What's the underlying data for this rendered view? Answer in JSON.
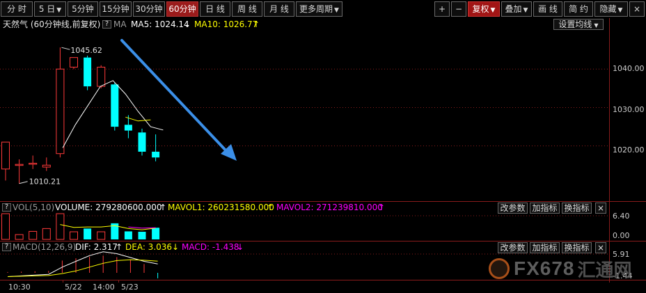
{
  "toolbar": {
    "periods": [
      {
        "label": "分 时"
      },
      {
        "label": "5 日",
        "dropdown": true
      },
      {
        "label": "5分钟"
      },
      {
        "label": "15分钟"
      },
      {
        "label": "30分钟"
      },
      {
        "label": "60分钟",
        "active": true
      },
      {
        "label": "日 线"
      },
      {
        "label": "周 线"
      },
      {
        "label": "月 线"
      },
      {
        "label": "更多周期",
        "dropdown": true
      }
    ],
    "right_buttons": [
      {
        "label": "+"
      },
      {
        "label": "−"
      },
      {
        "label": "复权",
        "dropdown": true,
        "highlight": true
      },
      {
        "label": "叠加",
        "dropdown": true
      },
      {
        "label": "画 线"
      },
      {
        "label": "简 约"
      },
      {
        "label": "隐藏",
        "dropdown": true
      },
      {
        "label": "×"
      }
    ]
  },
  "main": {
    "title": "天然气 (60分钟线,前复权)",
    "ma_label": "MA",
    "ma5_label": "MA5: 1024.14",
    "ma5_arrow": "↓",
    "ma10_label": "MA10: 1026.77",
    "ma10_arrow": "↑",
    "settings_button": "设置均线",
    "high_label": "1045.62",
    "low_label": "1010.21"
  },
  "volume": {
    "name": "VOL(5,10)",
    "value_label": "VOLUME: 279280600.000",
    "value_arrow": "↑",
    "mavol1_label": "MAVOL1: 260231580.000",
    "mavol1_arrow": "↑",
    "mavol2_label": "MAVOL2: 271239810.000",
    "mavol2_arrow": "↑",
    "buttons": [
      "改参数",
      "加指标",
      "换指标",
      "×"
    ]
  },
  "macd": {
    "name": "MACD(12,26,9)",
    "dif_label": "DIF: 2.317",
    "dif_arrow": "↑",
    "dea_label": "DEA: 3.036",
    "dea_arrow": "↓",
    "macd_label": "MACD: -1.438",
    "macd_arrow": "↓",
    "buttons": [
      "改参数",
      "加指标",
      "换指标",
      "×"
    ]
  },
  "watermark": {
    "text": "FX678",
    "cn": "汇通网"
  },
  "colors": {
    "up": "#ff3a3a",
    "down": "#00ffff",
    "ma5": "#ffffff",
    "ma10": "#ffff00",
    "mavol2": "#ff00ff",
    "grid": "#8a1c1c",
    "arrow": "#3b8fe8"
  },
  "chart_data": {
    "type": "candlestick",
    "price_axis_ticks": [
      "1040.00",
      "1030.00",
      "1020.00"
    ],
    "price_ylim": [
      1006,
      1050
    ],
    "volume_axis_ticks": [
      "6.40",
      "0.00"
    ],
    "macd_axis_ticks": [
      "5.91",
      "-1.44"
    ],
    "x_tick_labels": [
      "10:30",
      "5/22",
      "14:00",
      "5/23"
    ],
    "candles": [
      {
        "o": 1014,
        "h": 1021,
        "l": 1011,
        "c": 1021
      },
      {
        "o": 1015.2,
        "h": 1016.5,
        "l": 1010.21,
        "c": 1015.2
      },
      {
        "o": 1015.5,
        "h": 1017.5,
        "l": 1014,
        "c": 1015.5
      },
      {
        "o": 1014.5,
        "h": 1017,
        "l": 1013.5,
        "c": 1015
      },
      {
        "o": 1018,
        "h": 1045.62,
        "l": 1017,
        "c": 1040
      },
      {
        "o": 1040.5,
        "h": 1043,
        "l": 1040,
        "c": 1043
      },
      {
        "o": 1043,
        "h": 1043.5,
        "l": 1034.5,
        "c": 1035.5
      },
      {
        "o": 1035.5,
        "h": 1041,
        "l": 1035,
        "c": 1040.5
      },
      {
        "o": 1036,
        "h": 1036.5,
        "l": 1024,
        "c": 1025
      },
      {
        "o": 1025.5,
        "h": 1028,
        "l": 1022,
        "c": 1024
      },
      {
        "o": 1023.5,
        "h": 1024.5,
        "l": 1017.5,
        "c": 1018.5
      },
      {
        "o": 1018.5,
        "h": 1023,
        "l": 1016,
        "c": 1017
      }
    ],
    "ma5": [
      null,
      null,
      null,
      null,
      1019.5,
      1025.5,
      1030.5,
      1035.5,
      1037,
      1033.5,
      1029,
      1025,
      1024.14
    ],
    "ma10": [
      null,
      null,
      null,
      null,
      null,
      null,
      null,
      null,
      null,
      1027.5,
      1026.5,
      1026.77
    ],
    "volume_relative": [
      6.4,
      1.2,
      2.0,
      2.7,
      6.4,
      1.9,
      2.7,
      1.9,
      4.0,
      2.0,
      1.9,
      2.9
    ],
    "mavol1_relative": [
      null,
      null,
      null,
      null,
      3.7,
      3.0,
      3.1,
      3.1,
      3.4,
      2.7,
      2.4,
      2.8
    ],
    "mavol2_relative": [
      null,
      null,
      null,
      null,
      null,
      null,
      null,
      null,
      null,
      3.1,
      2.8,
      2.9
    ],
    "macd_hist": [
      0.2,
      0.3,
      0.4,
      0.5,
      3.2,
      3.8,
      4.2,
      4.5,
      4.1,
      3.3,
      2.3,
      -1.438
    ],
    "macd_dif": [
      -1.0,
      -0.8,
      -0.6,
      -0.4,
      1.5,
      3.0,
      4.5,
      5.5,
      5.0,
      4.0,
      3.0,
      2.317
    ],
    "macd_dea": [
      -1.0,
      -0.9,
      -0.8,
      -0.7,
      -0.2,
      0.5,
      1.5,
      2.5,
      3.2,
      3.4,
      3.3,
      3.036
    ],
    "annotation": "blue trend arrow pointing down-right"
  }
}
